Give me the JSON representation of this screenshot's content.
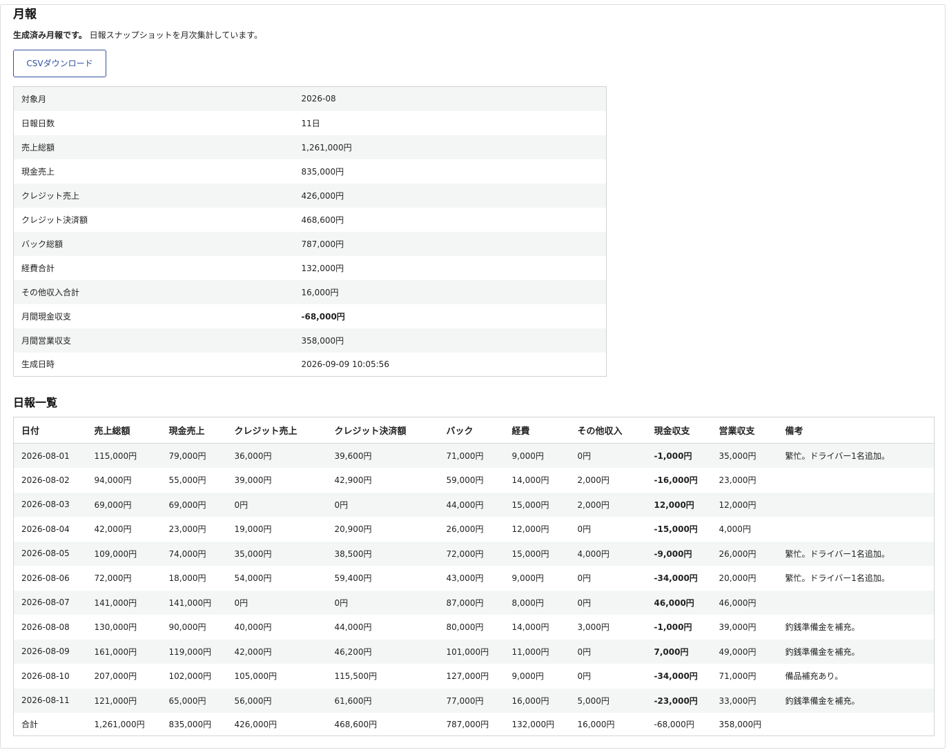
{
  "page": {
    "title": "月報",
    "lead_bold": "生成済み月報です。",
    "lead_text": "日報スナップショットを月次集計しています。",
    "csv_label": "CSVダウンロード"
  },
  "summary": [
    {
      "label": "対象月",
      "value": "2026-08"
    },
    {
      "label": "日報日数",
      "value": "11日"
    },
    {
      "label": "売上総額",
      "value": "1,261,000円"
    },
    {
      "label": "現金売上",
      "value": "835,000円"
    },
    {
      "label": "クレジット売上",
      "value": "426,000円"
    },
    {
      "label": "クレジット決済額",
      "value": "468,600円"
    },
    {
      "label": "バック総額",
      "value": "787,000円"
    },
    {
      "label": "経費合計",
      "value": "132,000円"
    },
    {
      "label": "その他収入合計",
      "value": "16,000円"
    },
    {
      "label": "月間現金収支",
      "value": "-68,000円"
    },
    {
      "label": "月間営業収支",
      "value": "358,000円"
    },
    {
      "label": "生成日時",
      "value": "2026-09-09 10:05:56"
    }
  ],
  "daily": {
    "title": "日報一覧",
    "headers": [
      "日付",
      "売上総額",
      "現金売上",
      "クレジット売上",
      "クレジット決済額",
      "バック",
      "経費",
      "その他収入",
      "現金収支",
      "営業収支",
      "備考"
    ],
    "rows": [
      [
        "2026-08-01",
        "115,000円",
        "79,000円",
        "36,000円",
        "39,600円",
        "71,000円",
        "9,000円",
        "0円",
        "-1,000円",
        "35,000円",
        "繁忙。ドライバー1名追加。"
      ],
      [
        "2026-08-02",
        "94,000円",
        "55,000円",
        "39,000円",
        "42,900円",
        "59,000円",
        "14,000円",
        "2,000円",
        "-16,000円",
        "23,000円",
        ""
      ],
      [
        "2026-08-03",
        "69,000円",
        "69,000円",
        "0円",
        "0円",
        "44,000円",
        "15,000円",
        "2,000円",
        "12,000円",
        "12,000円",
        ""
      ],
      [
        "2026-08-04",
        "42,000円",
        "23,000円",
        "19,000円",
        "20,900円",
        "26,000円",
        "12,000円",
        "0円",
        "-15,000円",
        "4,000円",
        ""
      ],
      [
        "2026-08-05",
        "109,000円",
        "74,000円",
        "35,000円",
        "38,500円",
        "72,000円",
        "15,000円",
        "4,000円",
        "-9,000円",
        "26,000円",
        "繁忙。ドライバー1名追加。"
      ],
      [
        "2026-08-06",
        "72,000円",
        "18,000円",
        "54,000円",
        "59,400円",
        "43,000円",
        "9,000円",
        "0円",
        "-34,000円",
        "20,000円",
        "繁忙。ドライバー1名追加。"
      ],
      [
        "2026-08-07",
        "141,000円",
        "141,000円",
        "0円",
        "0円",
        "87,000円",
        "8,000円",
        "0円",
        "46,000円",
        "46,000円",
        ""
      ],
      [
        "2026-08-08",
        "130,000円",
        "90,000円",
        "40,000円",
        "44,000円",
        "80,000円",
        "14,000円",
        "3,000円",
        "-1,000円",
        "39,000円",
        "釣銭準備金を補充。"
      ],
      [
        "2026-08-09",
        "161,000円",
        "119,000円",
        "42,000円",
        "46,200円",
        "101,000円",
        "11,000円",
        "0円",
        "7,000円",
        "49,000円",
        "釣銭準備金を補充。"
      ],
      [
        "2026-08-10",
        "207,000円",
        "102,000円",
        "105,000円",
        "115,500円",
        "127,000円",
        "9,000円",
        "0円",
        "-34,000円",
        "71,000円",
        "備品補充あり。"
      ],
      [
        "2026-08-11",
        "121,000円",
        "65,000円",
        "56,000円",
        "61,600円",
        "77,000円",
        "16,000円",
        "5,000円",
        "-23,000円",
        "33,000円",
        "釣銭準備金を補充。"
      ]
    ],
    "total": [
      "合計",
      "1,261,000円",
      "835,000円",
      "426,000円",
      "468,600円",
      "787,000円",
      "132,000円",
      "16,000円",
      "-68,000円",
      "358,000円",
      ""
    ]
  }
}
